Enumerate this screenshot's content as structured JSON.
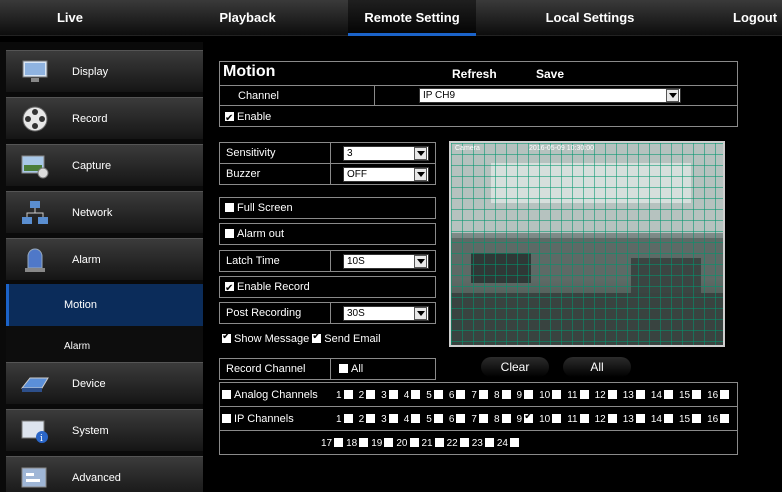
{
  "nav": {
    "tabs": [
      {
        "label": "Live"
      },
      {
        "label": "Playback"
      },
      {
        "label": "Remote Setting"
      },
      {
        "label": "Local Settings"
      },
      {
        "label": "Logout"
      }
    ]
  },
  "sidebar": {
    "items": [
      {
        "label": "Display",
        "icon": "monitor-icon"
      },
      {
        "label": "Record",
        "icon": "film-reel-icon"
      },
      {
        "label": "Capture",
        "icon": "camera-gear-icon"
      },
      {
        "label": "Network",
        "icon": "network-icon"
      },
      {
        "label": "Alarm",
        "icon": "alarm-light-icon"
      },
      {
        "label": "Device",
        "icon": "hard-drive-icon"
      },
      {
        "label": "System",
        "icon": "system-info-icon"
      },
      {
        "label": "Advanced",
        "icon": "advanced-settings-icon"
      }
    ],
    "subitems": [
      {
        "label": "Motion",
        "active": true
      },
      {
        "label": "Alarm",
        "active": false
      }
    ]
  },
  "panel": {
    "title": "Motion",
    "refresh_label": "Refresh",
    "save_label": "Save",
    "channel_label": "Channel",
    "channel_value": "IP CH9",
    "enable_label": "Enable",
    "sensitivity_label": "Sensitivity",
    "sensitivity_value": "3",
    "buzzer_label": "Buzzer",
    "buzzer_value": "OFF",
    "full_screen_label": "Full Screen",
    "alarm_out_label": "Alarm out",
    "latch_time_label": "Latch Time",
    "latch_time_value": "10S",
    "enable_record_label": "Enable Record",
    "post_recording_label": "Post Recording",
    "post_recording_value": "30S",
    "show_message_label": "Show Message",
    "send_email_label": "Send Email",
    "record_channel_label": "Record Channel",
    "all_label": "All",
    "clear_button": "Clear",
    "all_button": "All",
    "preview_channel_text": "Camera",
    "preview_timestamp": "2016-05-09 10:30:00",
    "analog_channels_label": "Analog Channels",
    "ip_channels_label": "IP Channels",
    "analog_numbers": [
      "1",
      "2",
      "3",
      "4",
      "5",
      "6",
      "7",
      "8",
      "9",
      "10",
      "11",
      "12",
      "13",
      "14",
      "15",
      "16"
    ],
    "ip_numbers_row1": [
      "1",
      "2",
      "3",
      "4",
      "5",
      "6",
      "7",
      "8",
      "9",
      "10",
      "11",
      "12",
      "13",
      "14",
      "15",
      "16"
    ],
    "ip_numbers_row2": [
      "17",
      "18",
      "19",
      "20",
      "21",
      "22",
      "23",
      "24"
    ],
    "ip_checked": [
      "9"
    ]
  },
  "colors": {
    "accent": "#1b63c9",
    "motion_grid": "#00966e"
  }
}
